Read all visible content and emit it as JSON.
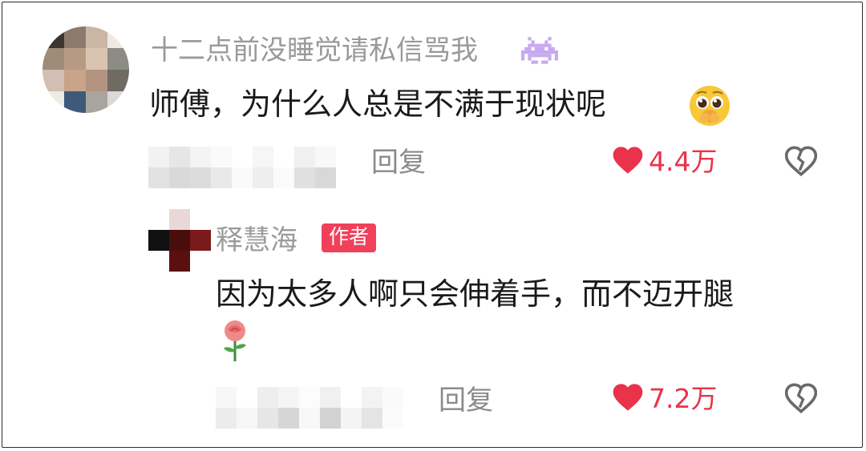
{
  "comment": {
    "username": "十二点前没睡觉请私信骂我",
    "username_icon": "space-invader-icon",
    "text": "师傅，为什么人总是不满于现状呢",
    "text_emoji": "pleading-face-icon",
    "reply_label": "回复",
    "like_count": "4.4万",
    "like_icon": "heart-icon",
    "dislike_icon": "broken-heart-icon"
  },
  "reply": {
    "username": "释慧海",
    "author_badge": "作者",
    "text": "因为太多人啊只会伸着手，而不迈开腿",
    "text_emoji": "rose-icon",
    "reply_label": "回复",
    "like_count": "7.2万",
    "like_icon": "heart-icon",
    "dislike_icon": "broken-heart-icon"
  },
  "colors": {
    "accent": "#e8334b",
    "badge": "#f0405a",
    "username": "#9a9a9a",
    "text": "#1a1a1a"
  }
}
